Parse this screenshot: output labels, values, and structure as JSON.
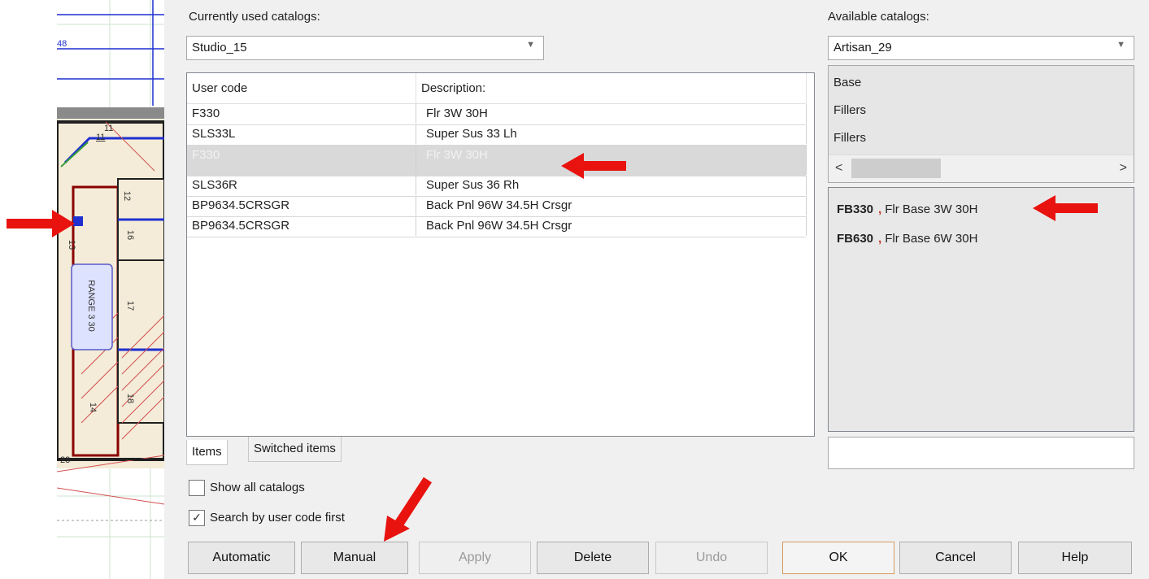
{
  "drawing": {
    "dimension_label": "48",
    "cabinet_labels": [
      "11",
      "11",
      "12",
      "13",
      "16",
      "17",
      "18",
      "14"
    ],
    "range_label": "RANGE 3 30",
    "bottom_label": "23"
  },
  "left": {
    "current_label": "Currently used catalogs:",
    "current_value": "Studio_15",
    "table": {
      "headers": [
        "User code",
        "Description:"
      ],
      "rows": [
        {
          "code": "F330",
          "desc": "Flr 3W 30H"
        },
        {
          "code": "SLS33L",
          "desc": "Super Sus 33 Lh"
        },
        {
          "code": "F330",
          "desc": "Flr 3W 30H"
        },
        {
          "code": "SLS36R",
          "desc": "Super Sus 36 Rh"
        },
        {
          "code": "BP9634.5CRSGR",
          "desc": "Back Pnl 96W 34.5H Crsgr"
        },
        {
          "code": "BP9634.5CRSGR",
          "desc": "Back Pnl 96W 34.5H Crsgr"
        }
      ]
    },
    "tabs": [
      "Items",
      "Switched items"
    ],
    "show_all": "Show all catalogs",
    "search_first": "Search by user code first"
  },
  "right": {
    "available_label": "Available catalogs:",
    "available_value": "Artisan_29",
    "catalog_list": [
      "Base",
      "Fillers",
      "Fillers"
    ],
    "results": [
      {
        "code": "FB330",
        "desc": "Flr Base 3W 30H"
      },
      {
        "code": "FB630",
        "desc": "Flr Base 6W 30H"
      }
    ],
    "search_value": ""
  },
  "buttons": {
    "automatic": "Automatic",
    "manual": "Manual",
    "apply": "Apply",
    "delete": "Delete",
    "undo": "Undo",
    "ok": "OK",
    "cancel": "Cancel",
    "help": "Help"
  },
  "colors": {
    "accent_arrow": "#e8130f",
    "selected_row": "#d9d9d9",
    "ok_border": "#d59c5e"
  }
}
